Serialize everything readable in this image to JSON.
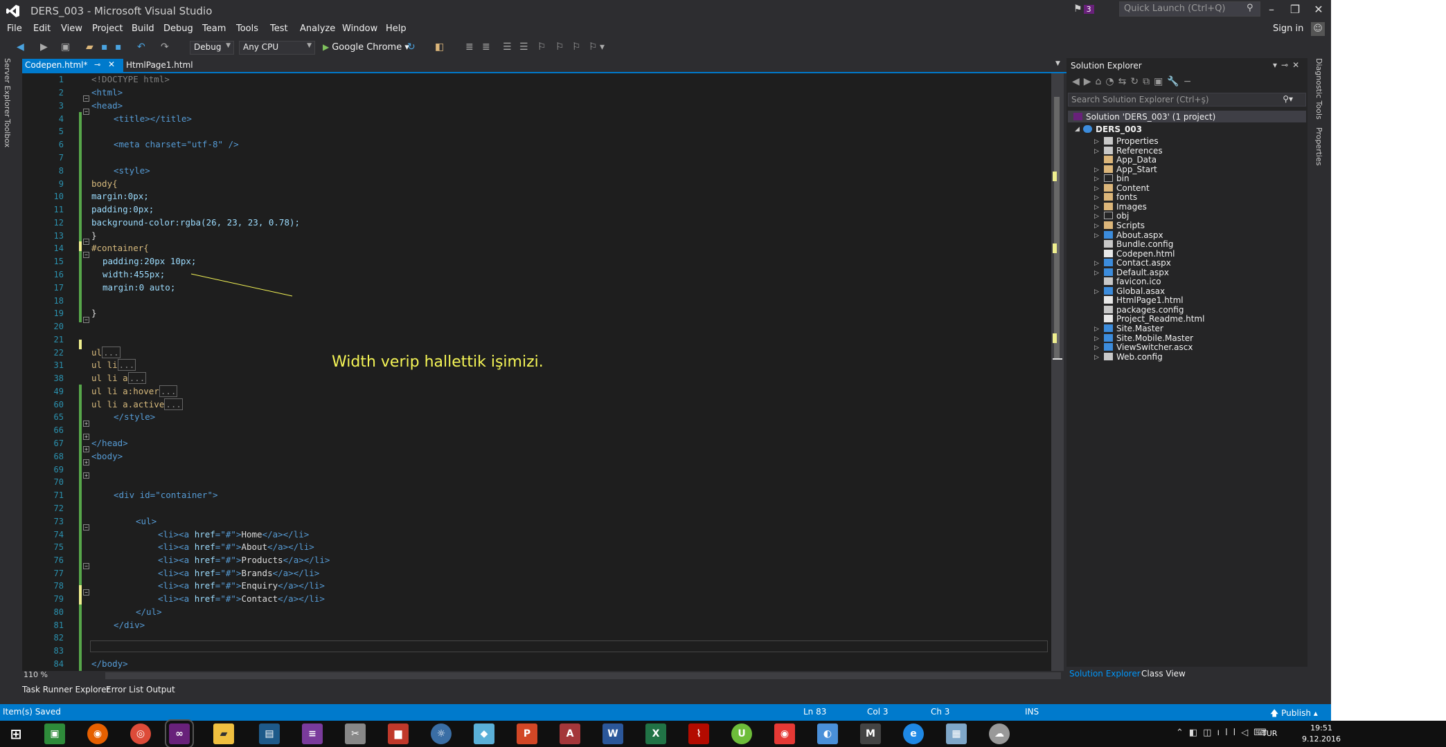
{
  "window": {
    "title": "DERS_003 - Microsoft Visual Studio",
    "notification_count": "3",
    "quick_launch_placeholder": "Quick Launch (Ctrl+Q)"
  },
  "menu": [
    "File",
    "Edit",
    "View",
    "Project",
    "Build",
    "Debug",
    "Team",
    "Tools",
    "Test",
    "Analyze",
    "Window",
    "Help"
  ],
  "signin": "Sign in",
  "toolbar": {
    "configuration": "Debug",
    "platform": "Any CPU",
    "run_target": "Google Chrome"
  },
  "left_rail": [
    "Server Explorer",
    "Toolbox"
  ],
  "tabs": {
    "active": "Codepen.html*",
    "inactive": "HtmlPage1.html"
  },
  "editor": {
    "zoom": "110 %",
    "callout": "Width verip hallettik işimizi.",
    "line_numbers": [
      "1",
      "2",
      "3",
      "4",
      "5",
      "6",
      "7",
      "8",
      "9",
      "10",
      "11",
      "12",
      "13",
      "14",
      "15",
      "16",
      "17",
      "18",
      "19",
      "20",
      "21",
      "22",
      "31",
      "38",
      "49",
      "60",
      "65",
      "66",
      "67",
      "68",
      "69",
      "70",
      "71",
      "72",
      "73",
      "74",
      "75",
      "76",
      "77",
      "78",
      "79",
      "80",
      "81",
      "82",
      "83",
      "84"
    ],
    "code": {
      "l1": "<!DOCTYPE html>",
      "l2": "<html>",
      "l3": "<head>",
      "l4": "<title></title>",
      "l6": "<meta charset=\"utf-8\" />",
      "l8": "<style>",
      "l9": "body{",
      "l10": "margin:0px;",
      "l11": "padding:0px;",
      "l12": "background-color:rgba(26, 23, 23, 0.78);",
      "l13": "}",
      "l14": "#container{",
      "l15": "padding:20px 10px;",
      "l16": "width:455px;",
      "l17": "margin:0 auto;",
      "l19": "}",
      "l22": "ul",
      "l31": "ul li",
      "l38": "ul li a",
      "l49": "ul li a:hover",
      "l60": "ul li a.active",
      "fold_marker": "...",
      "l65": "</style>",
      "l67": "</head>",
      "l68": "<body>",
      "l71": "<div id=\"container\">",
      "l73": "<ul>",
      "nav_items": [
        "Home",
        "About",
        "Products",
        "Brands",
        "Enquiry",
        "Contact"
      ],
      "l80": "</ul>",
      "l81": "</div>",
      "l84": "</body>"
    }
  },
  "bottom_tabs": [
    "Task Runner Explorer",
    "Error List",
    "Output"
  ],
  "solution_explorer": {
    "title": "Solution Explorer",
    "search_placeholder": "Search Solution Explorer (Ctrl+ş)",
    "solution": "Solution 'DERS_003' (1 project)",
    "project": "DERS_003",
    "items": [
      {
        "name": "Properties",
        "icon": "wrench-icon",
        "expandable": true
      },
      {
        "name": "References",
        "icon": "references-icon",
        "expandable": true
      },
      {
        "name": "App_Data",
        "icon": "folder-icon",
        "expandable": false
      },
      {
        "name": "App_Start",
        "icon": "folder-icon",
        "expandable": true
      },
      {
        "name": "bin",
        "icon": "folder-outline-icon",
        "expandable": true
      },
      {
        "name": "Content",
        "icon": "folder-icon",
        "expandable": true
      },
      {
        "name": "fonts",
        "icon": "folder-icon",
        "expandable": true
      },
      {
        "name": "Images",
        "icon": "folder-icon",
        "expandable": true
      },
      {
        "name": "obj",
        "icon": "folder-outline-icon",
        "expandable": true
      },
      {
        "name": "Scripts",
        "icon": "folder-icon",
        "expandable": true
      },
      {
        "name": "About.aspx",
        "icon": "aspx-file-icon",
        "expandable": true
      },
      {
        "name": "Bundle.config",
        "icon": "config-file-icon",
        "expandable": false
      },
      {
        "name": "Codepen.html",
        "icon": "html-file-icon",
        "expandable": false
      },
      {
        "name": "Contact.aspx",
        "icon": "aspx-file-icon",
        "expandable": true
      },
      {
        "name": "Default.aspx",
        "icon": "aspx-file-icon",
        "expandable": true
      },
      {
        "name": "favicon.ico",
        "icon": "ico-file-icon",
        "expandable": false
      },
      {
        "name": "Global.asax",
        "icon": "asax-file-icon",
        "expandable": true
      },
      {
        "name": "HtmlPage1.html",
        "icon": "html-file-icon",
        "expandable": false
      },
      {
        "name": "packages.config",
        "icon": "config-file-icon",
        "expandable": false
      },
      {
        "name": "Project_Readme.html",
        "icon": "html-file-icon",
        "expandable": false
      },
      {
        "name": "Site.Master",
        "icon": "master-file-icon",
        "expandable": true
      },
      {
        "name": "Site.Mobile.Master",
        "icon": "master-file-icon",
        "expandable": true
      },
      {
        "name": "ViewSwitcher.ascx",
        "icon": "ascx-file-icon",
        "expandable": true
      },
      {
        "name": "Web.config",
        "icon": "config-file-icon",
        "expandable": true
      }
    ],
    "bottom_tabs": [
      "Solution Explorer",
      "Class View"
    ]
  },
  "right_rail": [
    "Diagnostic Tools",
    "Properties"
  ],
  "status": {
    "message": "Item(s) Saved",
    "ln": "Ln 83",
    "col": "Col 3",
    "ch": "Ch 3",
    "mode": "INS",
    "publish": "Publish"
  },
  "taskbar": {
    "lang": "TUR",
    "time": "19:51",
    "date": "9.12.2016"
  },
  "colors": {
    "accent": "#007acc",
    "editor_bg": "#1e1e1e",
    "callout": "#f5f556"
  }
}
